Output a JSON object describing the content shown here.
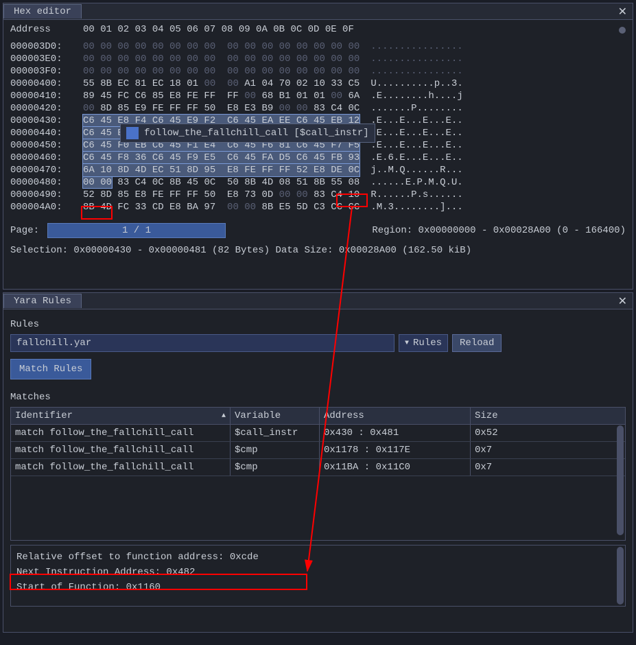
{
  "hex_panel": {
    "title": "Hex editor",
    "header_address": "Address",
    "header_bytes": "00 01 02 03 04 05 06 07  08 09 0A 0B 0C 0D 0E 0F",
    "rows": [
      {
        "addr": "000003D0:",
        "bytes": "00 00 00 00 00 00 00 00  00 00 00 00 00 00 00 00",
        "ascii": "................",
        "dim": true
      },
      {
        "addr": "000003E0:",
        "bytes": "00 00 00 00 00 00 00 00  00 00 00 00 00 00 00 00",
        "ascii": "................",
        "dim": true
      },
      {
        "addr": "000003F0:",
        "bytes": "00 00 00 00 00 00 00 00  00 00 00 00 00 00 00 00",
        "ascii": "................",
        "dim": true
      },
      {
        "addr": "00000400:",
        "bytes": "55 8B EC 81 EC 18 01 00  00 A1 04 70 02 10 33 C5",
        "ascii": "U..........p..3."
      },
      {
        "addr": "00000410:",
        "bytes": "89 45 FC C6 85 E8 FE FF  FF 00 68 B1 01 01 00 6A",
        "ascii": ".E........h....j"
      },
      {
        "addr": "00000420:",
        "bytes": "00 8D 85 E9 FE FF FF 50  E8 E3 B9 00 00 83 C4 0C",
        "ascii": ".......P........"
      },
      {
        "addr": "00000430:",
        "bytes": "C6 45 E8 F4 C6 45 E9 F2  C6 45 EA EE C6 45 EB 12",
        "ascii": ".E...E...E...E..",
        "sel": true
      },
      {
        "addr": "00000440:",
        "bytes": "C6 45 EC 00 C6 45 ED FB  C6 45 EE EA C6 45 EF EB",
        "ascii": ".E...E...E...E..",
        "sel": true
      },
      {
        "addr": "00000450:",
        "bytes": "C6 45 F0 EB C6 45 F1 E4  C6 45 F6 81 C6 45 F7 F5",
        "ascii": ".E...E...E...E..",
        "sel": true
      },
      {
        "addr": "00000460:",
        "bytes": "C6 45 F8 36 C6 45 F9 E5  C6 45 FA D5 C6 45 FB 93",
        "ascii": ".E.6.E...E...E..",
        "sel": true
      },
      {
        "addr": "00000470:",
        "bytes": "6A 10 8D 4D EC 51 8D 95  E8 FE FF FF 52 E8 DE 0C",
        "ascii": "j..M.Q......R...",
        "sel": true
      },
      {
        "addr": "00000480:",
        "bytes": "00 00 83 C4 0C 8B 45 0C  50 8B 4D 08 51 8B 55 08",
        "ascii": "......E.P.M.Q.U.",
        "partial_sel": 2
      },
      {
        "addr": "00000490:",
        "bytes": "52 8D 85 E8 FE FF FF 50  E8 73 0D 00 00 83 C4 10",
        "ascii": "R......P.s......"
      },
      {
        "addr": "000004A0:",
        "bytes": "8B 4D FC 33 CD E8 BA 97  00 00 8B E5 5D C3 CC CC",
        "ascii": ".M.3........]..."
      }
    ],
    "page_label": "Page:",
    "page_value": "1 / 1",
    "region_text": "Region: 0x00000000 - 0x00028A00 (0 - 166400)",
    "selection_text": "Selection: 0x00000430 - 0x00000481 (82 Bytes) Data Size: 0x00028A00 (162.50 kiB)",
    "tooltip": "follow_the_fallchill_call [$call_instr]"
  },
  "yara_panel": {
    "title": "Yara Rules",
    "rules_label": "Rules",
    "file_input": "fallchill.yar",
    "dropdown_label": "Rules",
    "reload_btn": "Reload",
    "match_btn": "Match Rules",
    "matches_label": "Matches",
    "headers": {
      "id": "Identifier",
      "var": "Variable",
      "addr": "Address",
      "size": "Size"
    },
    "rows": [
      {
        "id": "match follow_the_fallchill_call",
        "var": "$call_instr",
        "addr": "0x430 : 0x481",
        "size": "0x52"
      },
      {
        "id": "match follow_the_fallchill_call",
        "var": "$cmp",
        "addr": "0x1178 : 0x117E",
        "size": "0x7"
      },
      {
        "id": "match follow_the_fallchill_call",
        "var": "$cmp",
        "addr": "0x11BA : 0x11C0",
        "size": "0x7"
      }
    ],
    "info": {
      "line1": "Relative offset to function address: 0xcde",
      "line2": "Next Instruction Address: 0x482",
      "line3": "Start of Function: 0x1160"
    }
  }
}
